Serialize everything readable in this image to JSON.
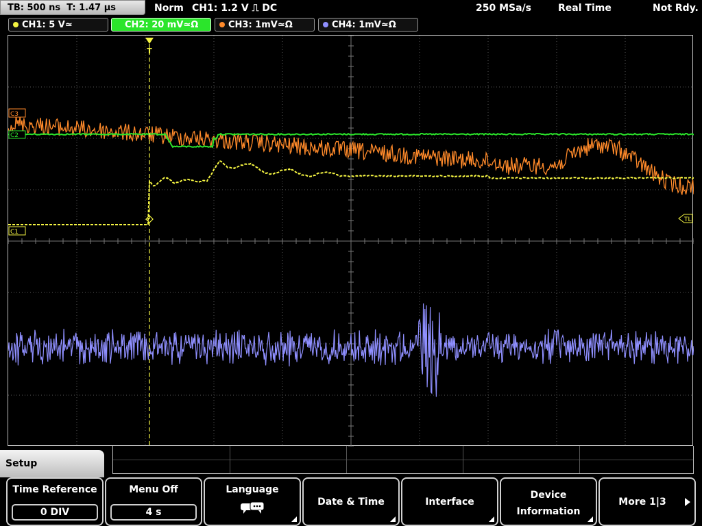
{
  "topbar": {
    "timebase": "TB: 500 ns  T: 1.47 µs",
    "mode": "Norm",
    "trigger": "CH1: 1.2 V ⎍ DC",
    "sample_rate": "250 MSa/s",
    "acq_mode": "Real Time",
    "status": "Not Rdy."
  },
  "channels": [
    {
      "label": "CH1: 5 V≃",
      "color": "#f5f542",
      "active": false
    },
    {
      "label": "CH2: 20 mV≃Ω",
      "color": "#2be52b",
      "active": true
    },
    {
      "label": "CH3: 1mV≃Ω",
      "color": "#ff8a2a",
      "active": false
    },
    {
      "label": "CH4: 1mV≃Ω",
      "color": "#8f8fff",
      "active": false
    }
  ],
  "markers": {
    "c3": "C3",
    "c2": "C2",
    "c1": "C1",
    "trigger_level": "TL",
    "trigger_position": "T"
  },
  "colors": {
    "ch1": "#f5f542",
    "ch2": "#2be52b",
    "ch3": "#ff8a2a",
    "ch4": "#8f8fff",
    "trigger": "#f5f542",
    "grid": "#5a5a5a"
  },
  "menu": {
    "title": "Setup",
    "softkeys": [
      {
        "title": "Time Reference",
        "value": "0 DIV"
      },
      {
        "title": "Menu Off",
        "value": "4 s"
      },
      {
        "title": "Language",
        "icon": "speech-bubbles-icon"
      },
      {
        "title": "Date & Time"
      },
      {
        "title": "Interface"
      },
      {
        "title_line1": "Device",
        "title_line2": "Information"
      },
      {
        "title": "More 1|3"
      }
    ]
  }
}
